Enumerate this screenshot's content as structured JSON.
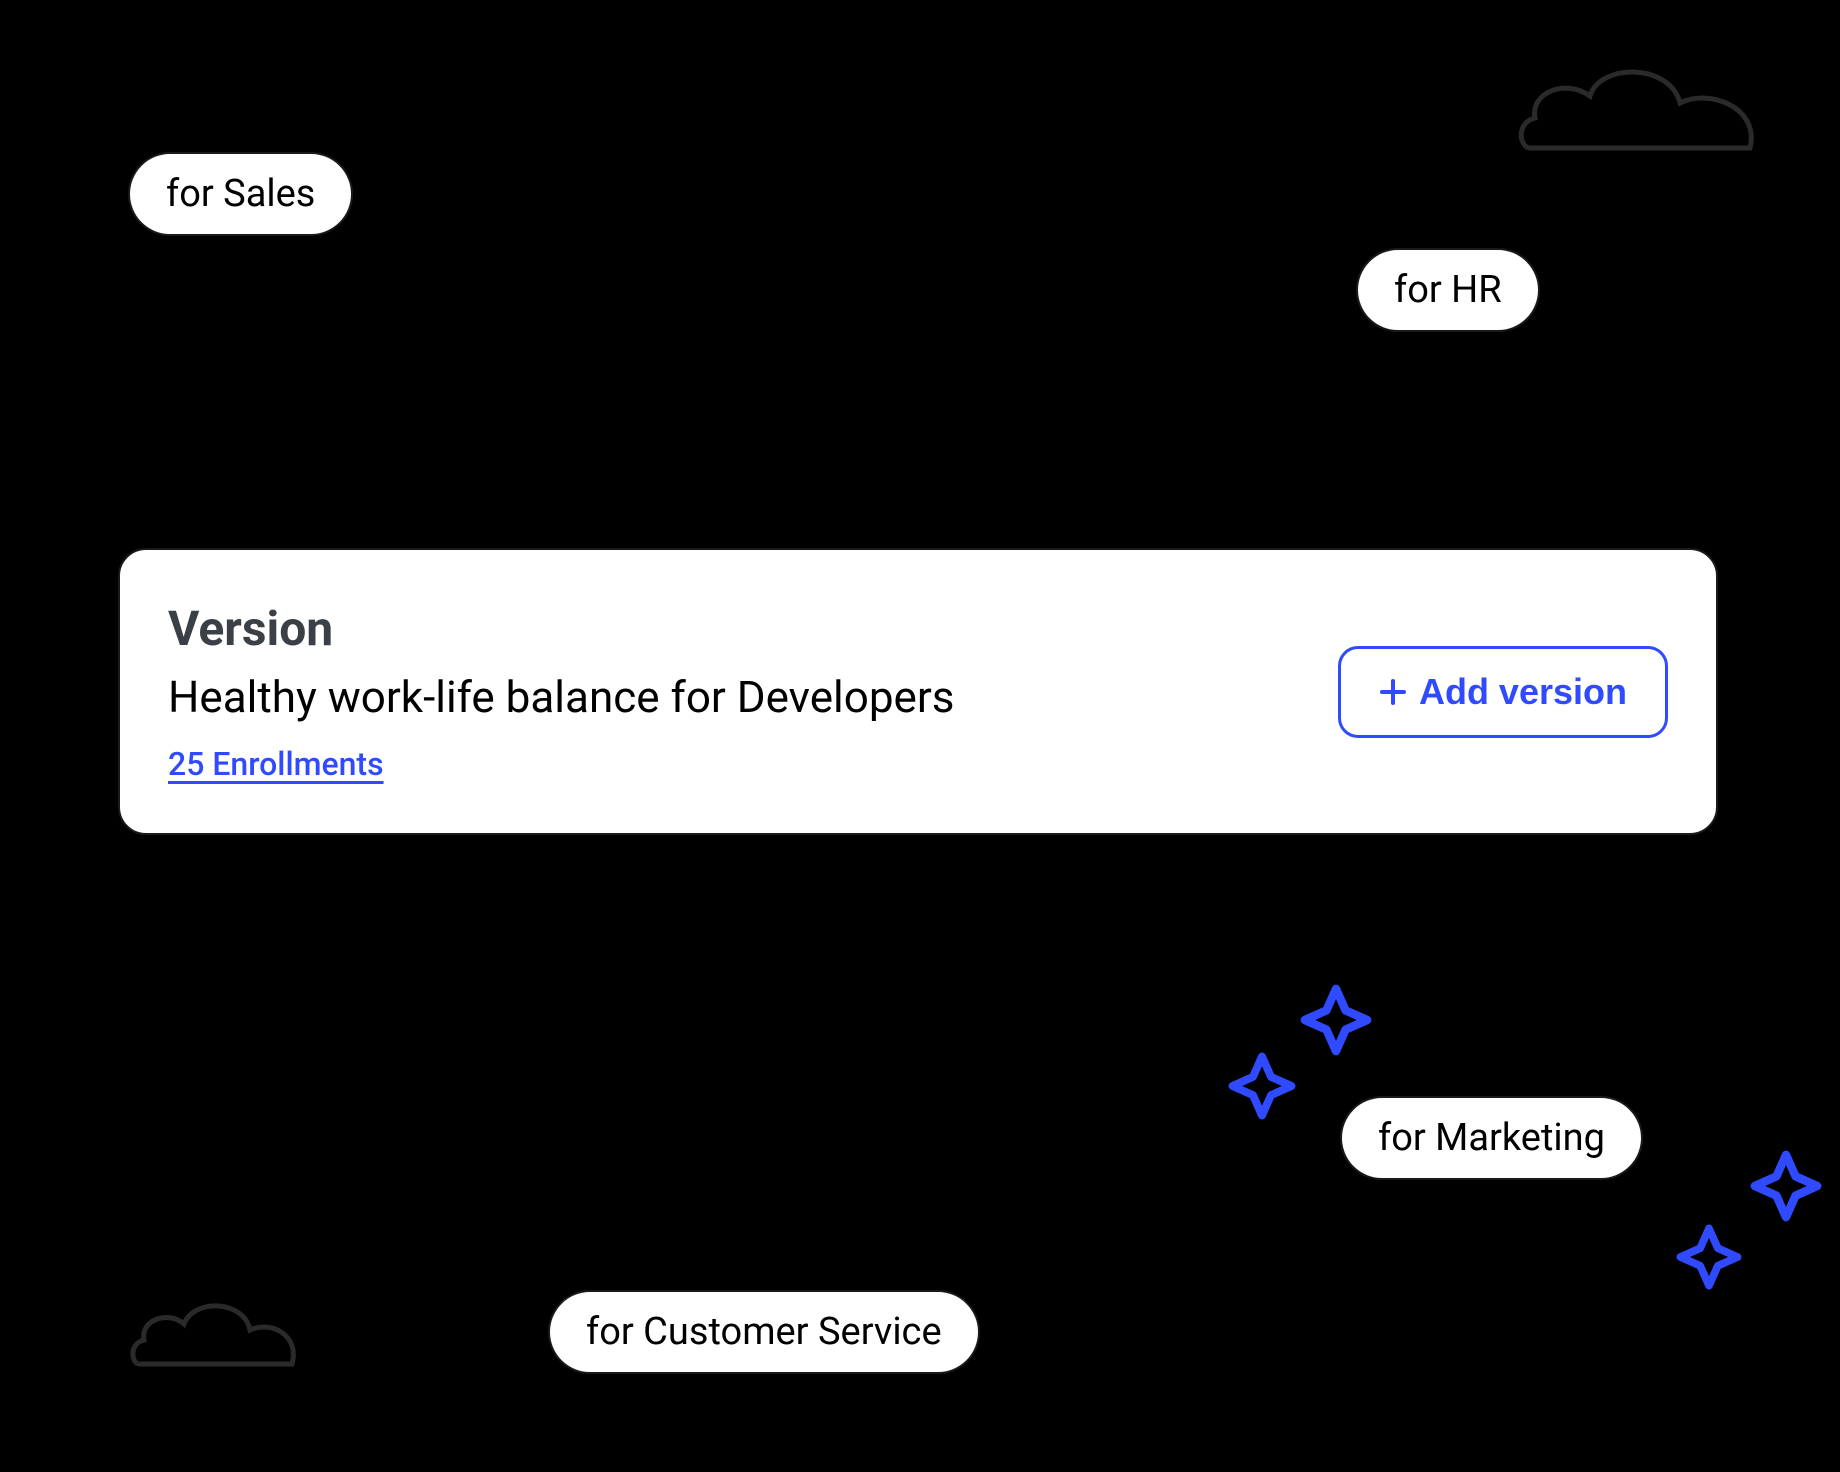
{
  "pills": {
    "sales": "for Sales",
    "hr": "for HR",
    "marketing": "for Marketing",
    "customer_service": "for Customer Service"
  },
  "card": {
    "heading": "Version",
    "title": "Healthy work-life balance for Developers",
    "enrollments_label": "25 Enrollments",
    "add_button_label": "Add version"
  },
  "colors": {
    "accent": "#2F4AFF",
    "background": "#000000",
    "card_bg": "#FFFFFF"
  }
}
